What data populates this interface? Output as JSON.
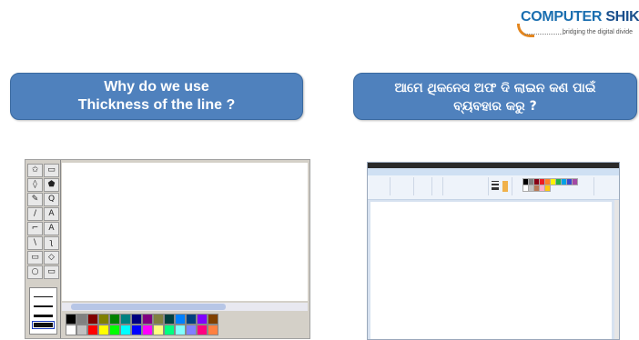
{
  "logo": {
    "brand_part1": "COMPUTER",
    "brand_part2": "SHIKSHA",
    "tagline": "bridging the digital divide"
  },
  "questions": {
    "english_line1": "Why do we use",
    "english_line2": "Thickness of the line ?",
    "odia_line1": "ଆମେ ଥିକନେସ ଅଫ ଦି  ଲାଇନ କଣ ପାଇଁ",
    "odia_line2": "ବ୍ୟବହାର କରୁ ?"
  },
  "old_paint": {
    "tool_glyphs": [
      "✩",
      "▭",
      "◊",
      "⬟",
      "✎",
      "Q",
      "/",
      "A",
      "⌐",
      "A",
      "\\",
      "ʅ",
      "▭",
      "◇",
      "○",
      "▭"
    ],
    "palette_top": [
      "#000000",
      "#808080",
      "#800000",
      "#808000",
      "#008000",
      "#008080",
      "#000080",
      "#800080",
      "#808040",
      "#004040",
      "#0080ff",
      "#004080",
      "#8000ff",
      "#804000"
    ],
    "palette_bottom": [
      "#ffffff",
      "#c0c0c0",
      "#ff0000",
      "#ffff00",
      "#00ff00",
      "#00ffff",
      "#0000ff",
      "#ff00ff",
      "#ffff80",
      "#00ff80",
      "#80ffff",
      "#8080ff",
      "#ff0080",
      "#ff8040"
    ]
  },
  "new_paint": {
    "palette": [
      "#000000",
      "#7f7f7f",
      "#880015",
      "#ed1c24",
      "#ff7f27",
      "#fff200",
      "#22b14c",
      "#00a2e8",
      "#3f48cc",
      "#a349a4",
      "#ffffff",
      "#c3c3c3",
      "#b97a57",
      "#ffaec9",
      "#ffc90e"
    ]
  }
}
